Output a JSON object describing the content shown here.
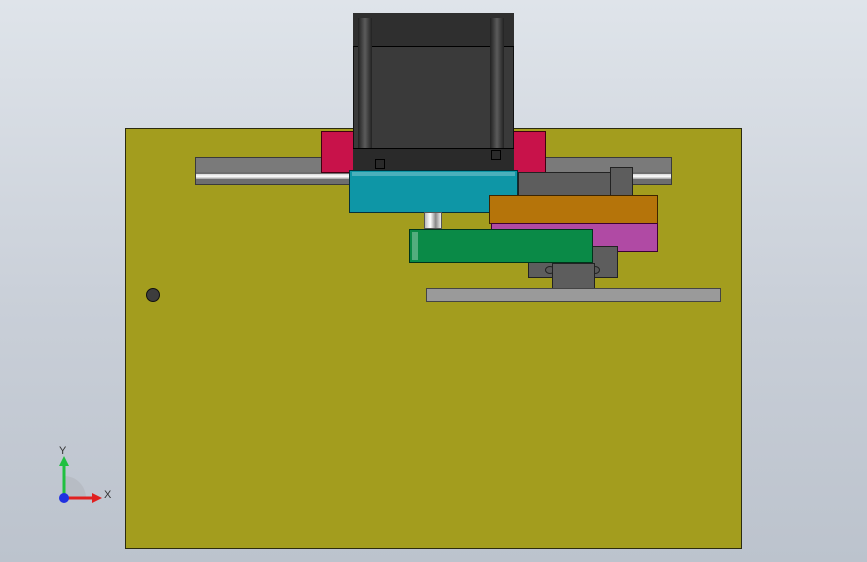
{
  "colors": {
    "plate": "#a39d1e",
    "rail": "#6e6e6e",
    "motor": "#3a3a3a",
    "mount": "#c8124a",
    "carriage": "#0e96a6",
    "cylinder_orange": "#b5740a",
    "cylinder_purple": "#b04aa4",
    "cylinder_green": "#0a8a47",
    "guide": "#9a9a9a",
    "slider": "#5d5d5d",
    "hole": "#3d3d3d"
  },
  "triad": {
    "x_label": "X",
    "y_label": "Y",
    "x_color": "#e02020",
    "y_color": "#20c040",
    "z_color": "#2030e0"
  }
}
